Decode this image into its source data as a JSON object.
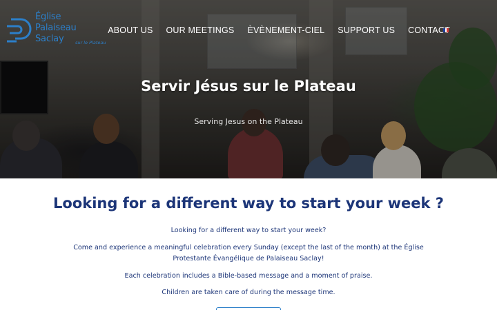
{
  "brand": {
    "logo_lines": [
      "Église",
      "Palaiseau",
      "Saclay"
    ],
    "logo_subline": "sur le Plateau",
    "color": "#2c7fc9"
  },
  "nav": {
    "items": [
      "ABOUT US",
      "OUR MEETINGS",
      "ÈVÈNEMENT-CIEL",
      "SUPPORT US",
      "CONTACT"
    ],
    "language_flag": "french-flag-icon"
  },
  "hero": {
    "title": "Servir Jésus sur le Plateau",
    "subtitle": "Serving Jesus on the Plateau"
  },
  "main": {
    "heading": "Looking for a different way to start your week ?",
    "paragraphs": [
      "Looking for a different way to start your week?",
      "Come and experience a meaningful celebration every Sunday (except the last of the month) at the Église Protestante Évangélique de Palaiseau Saclay!",
      "Each celebration includes a Bible-based message and a moment of praise.",
      "Children are taken care of during the message time."
    ],
    "heading_color": "#1c3578"
  }
}
